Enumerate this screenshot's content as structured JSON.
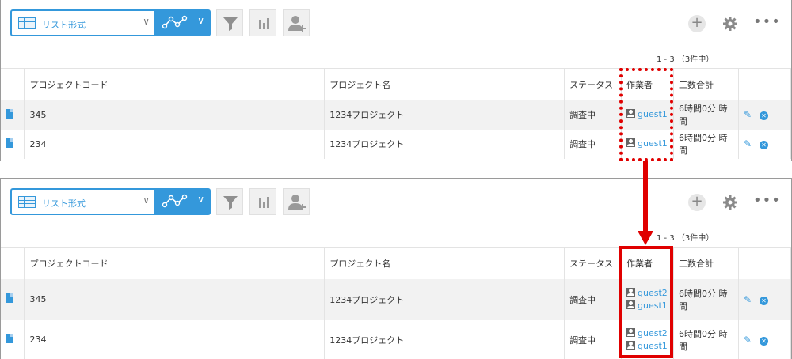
{
  "toolbar": {
    "view_label": "リスト形式"
  },
  "pager": "1 - 3 （3件中）",
  "columns": [
    "プロジェクトコード",
    "プロジェクト名",
    "ステータス",
    "作業者",
    "工数合計"
  ],
  "before": {
    "rows": [
      {
        "code": "345",
        "name": "1234プロジェクト",
        "status": "調査中",
        "users": [
          "guest1"
        ],
        "hours": "6時間0分 時間"
      },
      {
        "code": "234",
        "name": "1234プロジェクト",
        "status": "調査中",
        "users": [
          "guest1"
        ],
        "hours": "6時間0分 時間"
      }
    ]
  },
  "after": {
    "rows": [
      {
        "code": "345",
        "name": "1234プロジェクト",
        "status": "調査中",
        "users": [
          "guest2",
          "guest1"
        ],
        "hours": "6時間0分 時間"
      },
      {
        "code": "234",
        "name": "1234プロジェクト",
        "status": "調査中",
        "users": [
          "guest2",
          "guest1"
        ],
        "hours": "6時間0分 時間"
      }
    ]
  },
  "colors": {
    "accent": "#3498db",
    "highlight": "#e00000"
  }
}
